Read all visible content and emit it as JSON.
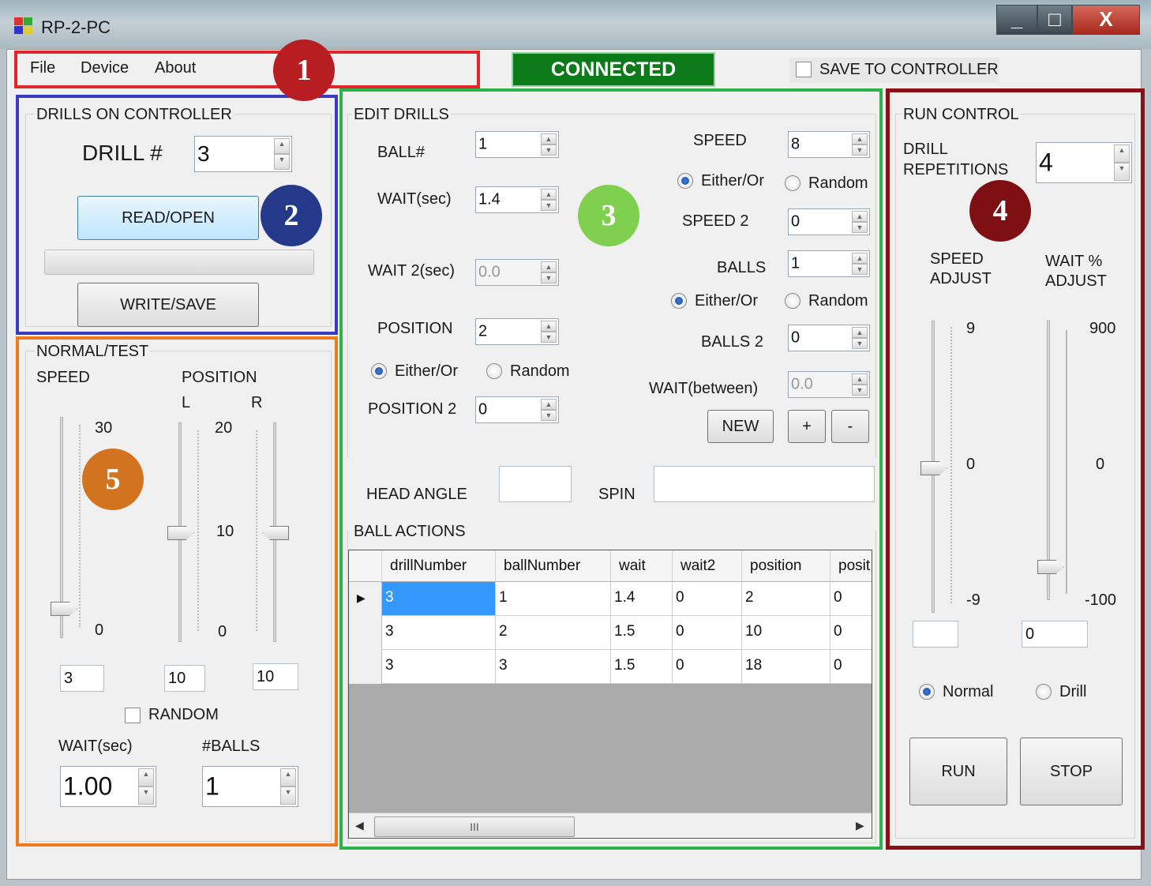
{
  "window": {
    "title": "RP-2-PC",
    "minimize": "_",
    "maximize": "□",
    "close": "X"
  },
  "menu": {
    "file": "File",
    "device": "Device",
    "about": "About"
  },
  "status": {
    "connected": "CONNECTED",
    "save_to_controller": "SAVE TO CONTROLLER"
  },
  "badges": {
    "b1": "1",
    "b2": "2",
    "b3": "3",
    "b4": "4",
    "b5": "5"
  },
  "colors": {
    "red": "#e0262b",
    "blue": "#3a3ac0",
    "green": "#2db24a",
    "darkred": "#8b1016",
    "orange": "#f07a1e",
    "badge1": "#b81d22",
    "badge2": "#24398a",
    "badge3": "#7fd04e",
    "badge4": "#7e1014",
    "badge5": "#d2731f",
    "connected_bg": "#0c7a18"
  },
  "drills_on_controller": {
    "title": "DRILLS ON CONTROLLER",
    "drill_label": "DRILL #",
    "drill_value": "3",
    "read_open": "READ/OPEN",
    "write_save": "WRITE/SAVE"
  },
  "normal_test": {
    "title": "NORMAL/TEST",
    "speed_label": "SPEED",
    "position_label": "POSITION",
    "l_label": "L",
    "r_label": "R",
    "speed_max": "30",
    "speed_min": "0",
    "pos_max": "20",
    "pos_mid": "10",
    "pos_min": "0",
    "speed_value": "3",
    "pos_l_value": "10",
    "pos_r_value": "10",
    "random_label": "RANDOM",
    "wait_label": "WAIT(sec)",
    "balls_label": "#BALLS",
    "wait_value": "1.00",
    "balls_value": "1"
  },
  "edit_drills": {
    "title": "EDIT DRILLS",
    "ball_label": "BALL#",
    "ball_value": "1",
    "wait_label": "WAIT(sec)",
    "wait_value": "1.4",
    "wait2_label": "WAIT 2(sec)",
    "wait2_value": "0.0",
    "position_label": "POSITION",
    "position_value": "2",
    "either_or": "Either/Or",
    "random": "Random",
    "position2_label": "POSITION 2",
    "position2_value": "0",
    "speed_label": "SPEED",
    "speed_value": "8",
    "speed2_label": "SPEED 2",
    "speed2_value": "0",
    "balls_label": "BALLS",
    "balls_value": "1",
    "balls2_label": "BALLS 2",
    "balls2_value": "0",
    "wait_between_label": "WAIT(between)",
    "wait_between_value": "0.0",
    "new": "NEW",
    "plus": "+",
    "minus": "-",
    "head_angle_label": "HEAD ANGLE",
    "spin_label": "SPIN",
    "ball_actions_label": "BALL ACTIONS"
  },
  "ball_actions": {
    "columns": [
      "drillNumber",
      "ballNumber",
      "wait",
      "wait2",
      "position",
      "posit"
    ],
    "rows": [
      [
        "3",
        "1",
        "1.4",
        "0",
        "2",
        "0"
      ],
      [
        "3",
        "2",
        "1.5",
        "0",
        "10",
        "0"
      ],
      [
        "3",
        "3",
        "1.5",
        "0",
        "18",
        "0"
      ]
    ],
    "scroll_thumb": "III"
  },
  "run_control": {
    "title": "RUN CONTROL",
    "reps_label_1": "DRILL",
    "reps_label_2": "REPETITIONS",
    "reps_value": "4",
    "speed_adj_1": "SPEED",
    "speed_adj_2": "ADJUST",
    "wait_adj_1": "WAIT %",
    "wait_adj_2": "ADJUST",
    "speed_max": "9",
    "speed_mid": "0",
    "speed_min": "-9",
    "wait_max": "900",
    "wait_mid": "0",
    "wait_min": "-100",
    "speed_adj_value": "",
    "wait_adj_value": "0",
    "normal": "Normal",
    "drill": "Drill",
    "run": "RUN",
    "stop": "STOP"
  }
}
